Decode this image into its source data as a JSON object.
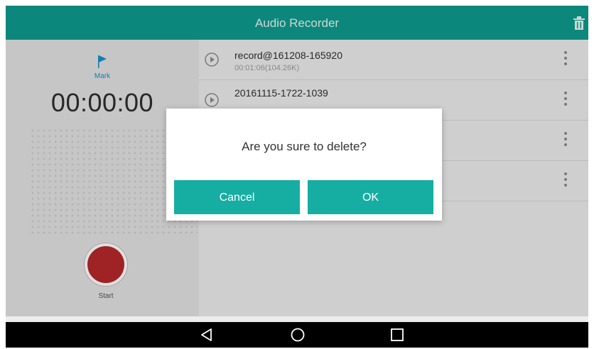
{
  "app": {
    "title": "Audio Recorder"
  },
  "recorder": {
    "mark_label": "Mark",
    "timer": "00:00:00",
    "start_label": "Start"
  },
  "recordings": [
    {
      "name": "record@161208-165920",
      "meta": "00:01:06(104.26K)"
    },
    {
      "name": "20161115-1722-1039",
      "meta": ""
    },
    {
      "name": "",
      "meta": ""
    },
    {
      "name": "",
      "meta": ""
    }
  ],
  "dialog": {
    "message": "Are you sure to delete?",
    "cancel_label": "Cancel",
    "ok_label": "OK"
  },
  "icons": {
    "header": [
      "trash-icon"
    ],
    "recorder": [
      "flag-icon"
    ],
    "list": [
      "play-icon",
      "more-vert-icon"
    ],
    "nav": [
      "back-icon",
      "home-icon",
      "recents-icon"
    ]
  },
  "colors": {
    "header": "#0e9a8c",
    "dialog_buttons": "#16ada2",
    "record_button": "#b5282a",
    "mark": "#1a90c8"
  }
}
